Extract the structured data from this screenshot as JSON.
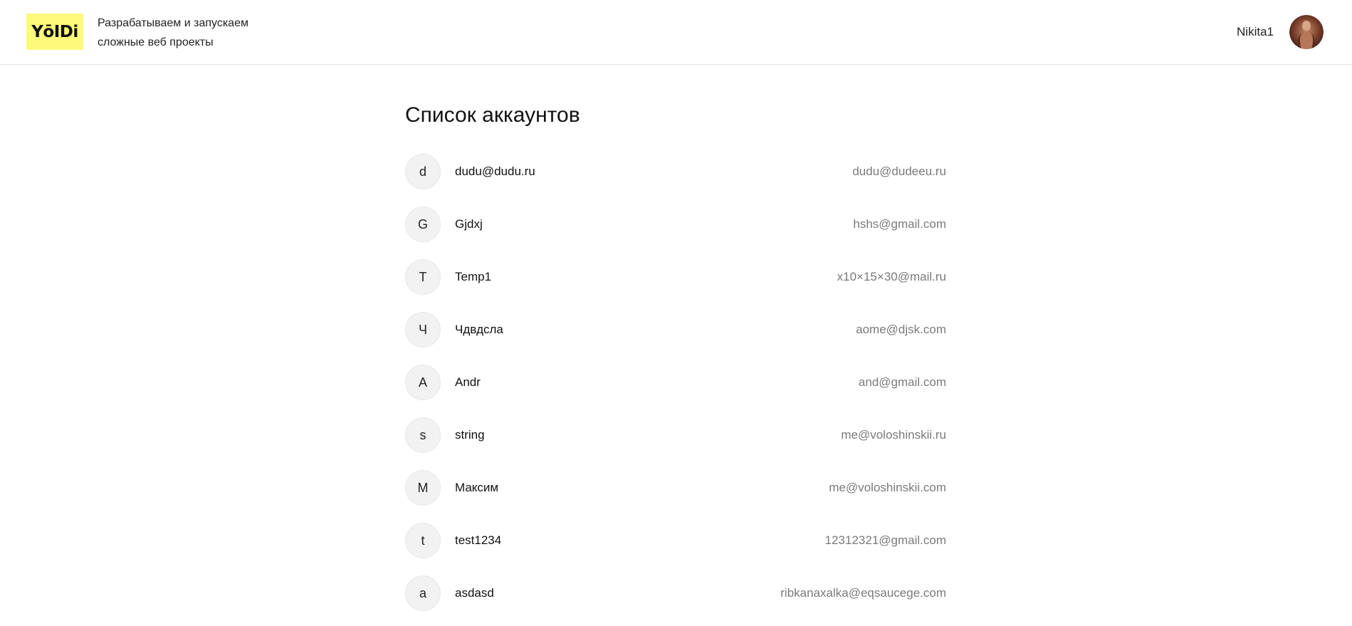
{
  "header": {
    "logo_text": "YōIDi",
    "tagline_line1": "Разрабатываем и запускаем",
    "tagline_line2": "сложные веб проекты",
    "username": "Nikita1"
  },
  "main": {
    "title": "Список аккаунтов",
    "accounts": [
      {
        "initial": "d",
        "name": "dudu@dudu.ru",
        "email": "dudu@dudeeu.ru"
      },
      {
        "initial": "G",
        "name": "Gjdxj",
        "email": "hshs@gmail.com"
      },
      {
        "initial": "T",
        "name": "Temp1",
        "email": "x10×15×30@mail.ru"
      },
      {
        "initial": "Ч",
        "name": "Чдвдсла",
        "email": "aome@djsk.com"
      },
      {
        "initial": "A",
        "name": "Andr",
        "email": "and@gmail.com"
      },
      {
        "initial": "s",
        "name": "string",
        "email": "me@voloshinskii.ru"
      },
      {
        "initial": "М",
        "name": "Максим",
        "email": "me@voloshinskii.com"
      },
      {
        "initial": "t",
        "name": "test1234",
        "email": "12312321@gmail.com"
      },
      {
        "initial": "a",
        "name": "asdasd",
        "email": "ribkanaxalka@eqsaucege.com"
      }
    ]
  },
  "colors": {
    "logo_background": "#fdf97a",
    "avatar_circle_background": "#f2f2f2",
    "email_text": "#7a7a7a"
  }
}
